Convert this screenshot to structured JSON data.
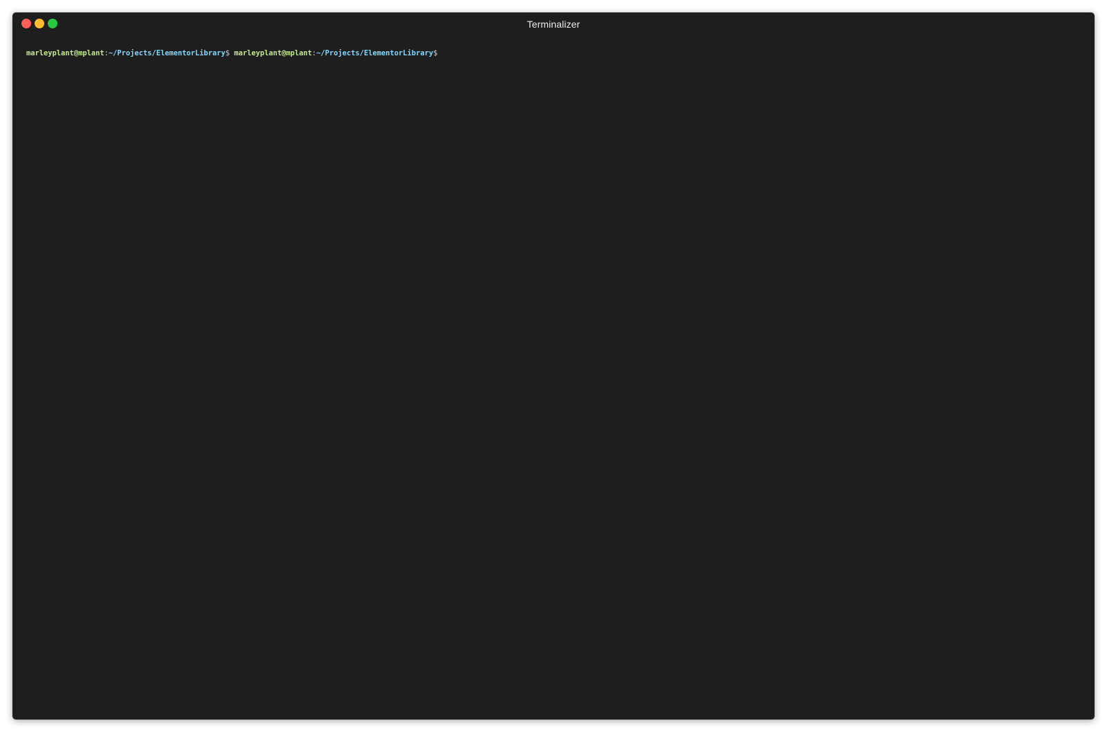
{
  "window": {
    "title": "Terminalizer",
    "controls": {
      "close_color": "#ff5f57",
      "minimize_color": "#febc2e",
      "maximize_color": "#28c840"
    }
  },
  "terminal": {
    "background": "#1e1e1e",
    "prompts": [
      {
        "user_host": "marleyplant@mplant",
        "separator": ":",
        "path": "~/Projects/ElementorLibrary",
        "symbol": "$"
      },
      {
        "user_host": "marleyplant@mplant",
        "separator": ":",
        "path": "~/Projects/ElementorLibrary",
        "symbol": "$"
      }
    ]
  }
}
